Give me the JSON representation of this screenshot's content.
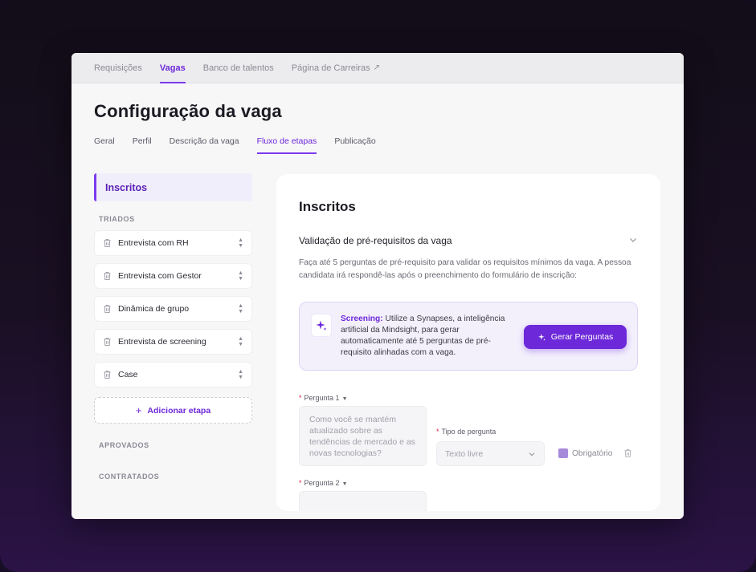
{
  "topnav": {
    "tabs": [
      {
        "label": "Requisições"
      },
      {
        "label": "Vagas"
      },
      {
        "label": "Banco de talentos"
      },
      {
        "label": "Página de Carreiras"
      }
    ],
    "external_icon": "↗"
  },
  "page": {
    "title": "Configuração da vaga",
    "subtabs": [
      {
        "label": "Geral"
      },
      {
        "label": "Perfil"
      },
      {
        "label": "Descrição da vaga"
      },
      {
        "label": "Fluxo de etapas"
      },
      {
        "label": "Publicação"
      }
    ]
  },
  "sidebar": {
    "current": "Inscritos",
    "section_triados": "TRIADOS",
    "stages": [
      {
        "label": "Entrevista com RH"
      },
      {
        "label": "Entrevista com Gestor"
      },
      {
        "label": "Dinâmica de grupo"
      },
      {
        "label": "Entrevista de screening"
      },
      {
        "label": "Case"
      }
    ],
    "add_stage": "Adicionar etapa",
    "section_aprovados": "APROVADOS",
    "section_contratados": "CONTRATADOS"
  },
  "main": {
    "title": "Inscritos",
    "accordion_title": "Validação de pré-requisitos da vaga",
    "description": "Faça até 5 perguntas de pré-requisito para validar os requisitos mínimos da vaga. A pessoa candidata irá respondê-las após o preenchimento do formulário de inscrição:",
    "screening": {
      "bold": "Screening:",
      "text": " Utilize a Synapses, a inteligência artificial da Mindsight, para gerar automaticamente até 5 perguntas de pré-requisito alinhadas com a vaga.",
      "button": "Gerar Perguntas"
    },
    "question1": {
      "label": "Pergunta 1",
      "placeholder": "Como você se mantém atualizado sobre as tendências de mercado e as novas tecnologias?"
    },
    "question_type": {
      "label": "Tipo de pergunta",
      "value": "Texto livre"
    },
    "required_label": "Obrigatório",
    "question2": {
      "label": "Pergunta 2"
    }
  },
  "colors": {
    "accent": "#6d28d9",
    "accent_light": "#f3f0fc",
    "required": "#e11d48"
  }
}
